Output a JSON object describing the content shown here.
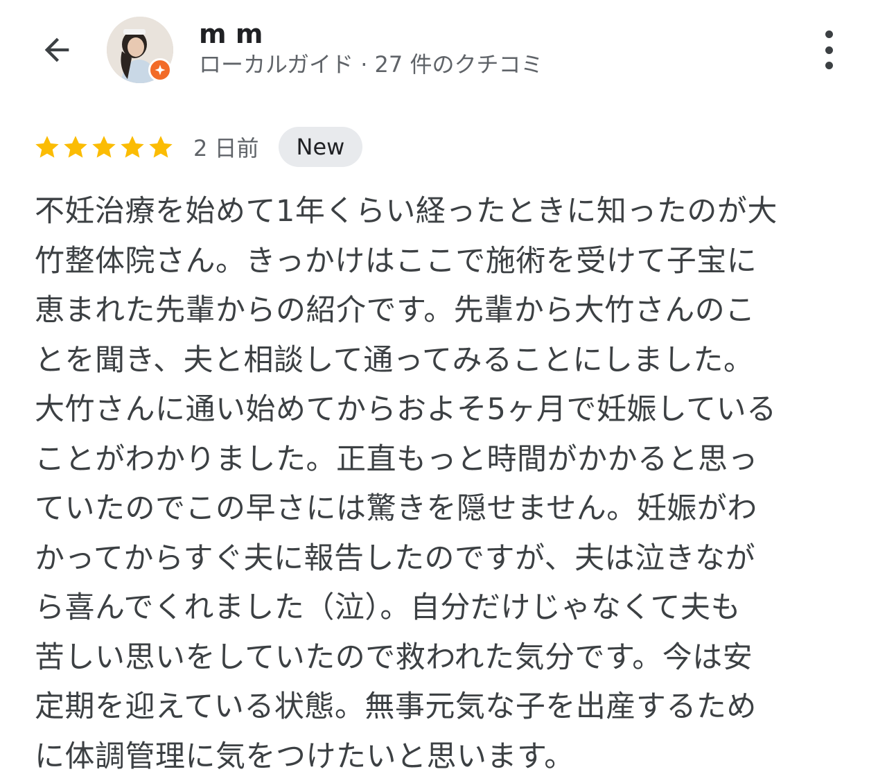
{
  "header": {
    "back_icon": "arrow-back-icon",
    "user_name": "m m",
    "user_meta": "ローカルガイド · 27 件のクチコミ",
    "avatar_badge_icon": "local-guide-star-icon",
    "more_icon": "more-vert-icon"
  },
  "review": {
    "rating": 5,
    "max_rating": 5,
    "star_color": "#fbbc04",
    "time_ago": "2 日前",
    "badge": "New",
    "text": "不妊治療を始めて1年くらい経ったときに知ったのが大\n竹整体院さん。きっかけはここで施術を受けて子宝に\n恵まれた先輩からの紹介です。先輩から大竹さんのこ\nとを聞き、夫と相談して通ってみることにしました。\n大竹さんに通い始めてからおよそ5ヶ月で妊娠している\nことがわかりました。正直もっと時間がかかると思っ\nていたのでこの早さには驚きを隠せません。妊娠がわ\nかってからすぐ夫に報告したのですが、夫は泣きなが\nら喜んでくれました（泣）。自分だけじゃなくて夫も\n苦しい思いをしていたので救われた気分です。今は安\n定期を迎えている状態。無事元気な子を出産するため\nに体調管理に気をつけたいと思います。"
  },
  "colors": {
    "badge_bg": "#e8eaed",
    "local_guide_badge": "#f26b28",
    "text_primary": "#202124",
    "text_secondary": "#5f6368"
  }
}
